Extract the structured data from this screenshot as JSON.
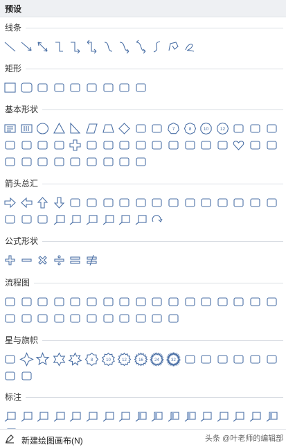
{
  "header": {
    "title": "预设"
  },
  "sections": [
    {
      "id": "lines",
      "title": "线条",
      "shapes": [
        "line",
        "arrow-line",
        "double-arrow-line",
        "elbow-connector",
        "elbow-arrow-connector",
        "elbow-double-arrow-connector",
        "curved-connector",
        "curved-arrow-connector",
        "curved-double-arrow-connector",
        "curve",
        "freeform",
        "scribble"
      ]
    },
    {
      "id": "rect",
      "title": "矩形",
      "shapes": [
        "rectangle",
        "rounded-rectangle",
        "snip-single-corner-rectangle",
        "snip-same-side-corner-rectangle",
        "snip-diagonal-corner-rectangle",
        "snip-and-round-single-corner-rectangle",
        "round-single-corner-rectangle",
        "round-same-side-corner-rectangle",
        "round-diagonal-corner-rectangle"
      ]
    },
    {
      "id": "basic",
      "title": "基本形状",
      "shapes": [
        "text-box",
        "vertical-text-box",
        "oval",
        "isosceles-triangle",
        "right-triangle",
        "parallelogram",
        "trapezoid",
        "diamond",
        "pentagon",
        "hexagon",
        "heptagon",
        "octagon",
        "decagon",
        "dodecagon",
        "pie",
        "chord",
        "teardrop",
        "frame",
        "half-frame",
        "l-shape",
        "diagonal-stripe",
        "cross",
        "plaque",
        "can",
        "cube",
        "bevel",
        "donut",
        "no-symbol",
        "block-arc",
        "folded-corner",
        "smiley-face",
        "heart",
        "lightning-bolt",
        "sun",
        "moon",
        "cloud",
        "arc",
        "double-bracket",
        "double-brace",
        "left-bracket",
        "right-bracket",
        "left-brace",
        "right-brace"
      ]
    },
    {
      "id": "arrows",
      "title": "箭头总汇",
      "shapes": [
        "right-arrow",
        "left-arrow",
        "up-arrow",
        "down-arrow",
        "left-right-arrow",
        "up-down-arrow",
        "quad-arrow",
        "left-right-up-arrow",
        "bent-arrow",
        "u-turn-arrow",
        "left-up-arrow",
        "bent-up-arrow",
        "curved-right-arrow",
        "curved-left-arrow",
        "curved-up-arrow",
        "curved-down-arrow",
        "striped-right-arrow",
        "notched-right-arrow",
        "pentagon-arrow",
        "chevron",
        "right-arrow-callout",
        "left-arrow-callout",
        "up-arrow-callout",
        "down-arrow-callout",
        "left-right-arrow-callout",
        "quad-arrow-callout",
        "circular-arrow"
      ]
    },
    {
      "id": "equation",
      "title": "公式形状",
      "shapes": [
        "plus",
        "minus",
        "multiply",
        "division",
        "equal",
        "not-equal"
      ]
    },
    {
      "id": "flowchart",
      "title": "流程图",
      "shapes": [
        "process",
        "alternate-process",
        "decision",
        "data",
        "predefined-process",
        "internal-storage",
        "document",
        "multidocument",
        "terminator",
        "preparation",
        "manual-input",
        "manual-operation",
        "connector",
        "off-page-connector",
        "card",
        "punched-tape",
        "summing-junction",
        "or",
        "collate",
        "sort",
        "extract",
        "merge",
        "stored-data",
        "delay",
        "sequential-access-storage",
        "magnetic-disk",
        "direct-access-storage",
        "display"
      ]
    },
    {
      "id": "stars",
      "title": "星与旗帜",
      "shapes": [
        "explosion-1",
        "star-4",
        "star-5",
        "star-6",
        "star-7",
        "star-8",
        "star-10",
        "star-12",
        "star-16",
        "star-24",
        "star-32",
        "ribbon-up",
        "ribbon-down",
        "curved-ribbon-up",
        "curved-ribbon-down",
        "vertical-scroll",
        "horizontal-scroll",
        "wave",
        "double-wave"
      ],
      "badges": {
        "star-8": "8",
        "star-10": "10",
        "star-12": "12",
        "star-16": "16",
        "star-24": "24",
        "star-32": "32"
      }
    },
    {
      "id": "callouts",
      "title": "标注",
      "shapes": [
        "rectangular-callout",
        "rounded-rectangular-callout",
        "oval-callout",
        "cloud-callout",
        "line-callout-1",
        "line-callout-2",
        "line-callout-3",
        "line-callout-4",
        "line-callout-1-accent",
        "line-callout-2-accent",
        "line-callout-3-accent",
        "line-callout-4-accent",
        "line-callout-1-no-border",
        "line-callout-2-no-border",
        "line-callout-3-no-border",
        "line-callout-4-no-border",
        "line-callout-1-border-accent",
        "line-callout-2-border-accent"
      ]
    }
  ],
  "badges": {
    "heptagon": "7",
    "octagon": "8",
    "decagon": "10",
    "dodecagon": "12"
  },
  "footer": {
    "label": "新建绘图画布(N)",
    "icon": "canvas-icon"
  },
  "watermark": "头条 @叶老师的编辑部",
  "colors": {
    "stroke": "#4a6fa5",
    "fill_accent": "#9db4d6",
    "header_bg": "#eef0f3"
  }
}
